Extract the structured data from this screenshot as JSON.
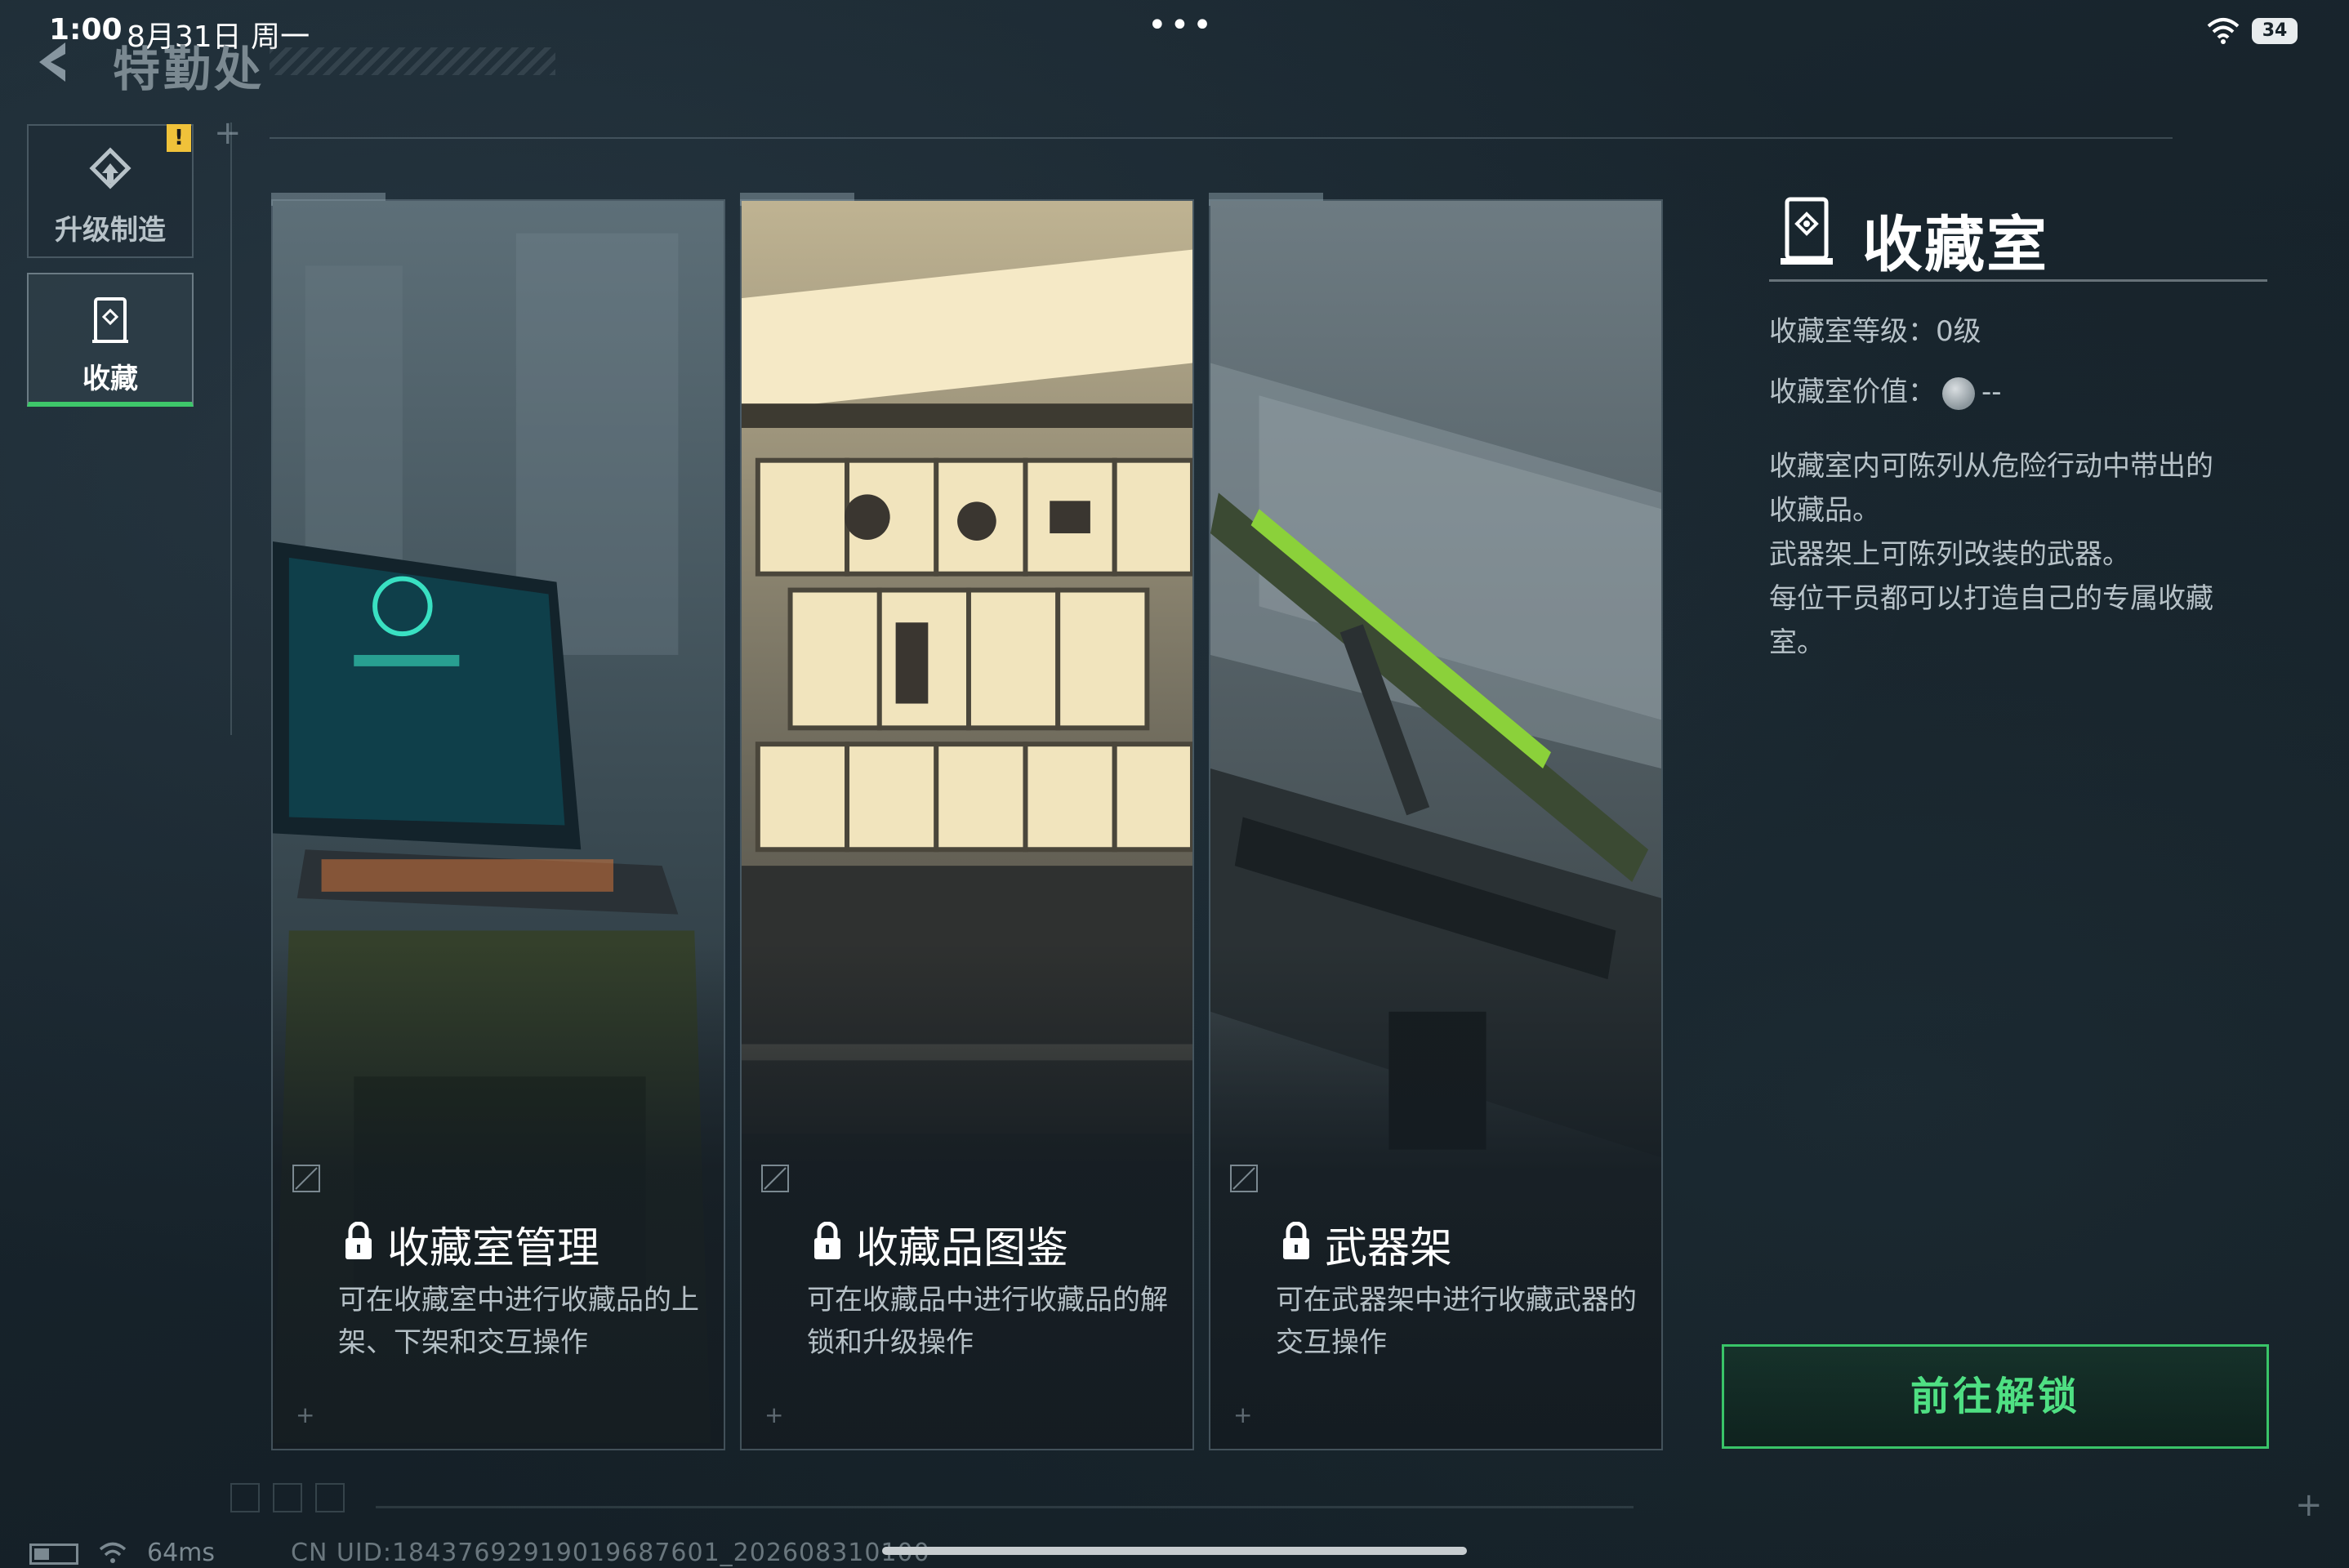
{
  "status_bar": {
    "time": "1:00",
    "date": "8月31日 周一",
    "more_dots": "•••",
    "battery": "34"
  },
  "header": {
    "title": "特勤处"
  },
  "sidebar": {
    "items": [
      {
        "label": "升级制造",
        "icon": "upgrade-craft-icon",
        "active": false,
        "alert": "!"
      },
      {
        "label": "收藏",
        "icon": "collection-room-icon",
        "active": true
      }
    ]
  },
  "cards": [
    {
      "title": "收藏室管理",
      "desc": "可在收藏室中进行收藏品的上架、下架和交互操作",
      "locked": true
    },
    {
      "title": "收藏品图鉴",
      "desc": "可在收藏品中进行收藏品的解锁和升级操作",
      "locked": true
    },
    {
      "title": "武器架",
      "desc": "可在武器架中进行收藏武器的交互操作",
      "locked": true
    }
  ],
  "panel": {
    "title": "收藏室",
    "level_label": "收藏室等级：",
    "level_value": "0级",
    "value_label": "收藏室价值：",
    "value_value": "--",
    "description": [
      "收藏室内可陈列从危险行动中带出的",
      "收藏品。",
      "武器架上可陈列改装的武器。",
      "每位干员都可以打造自己的专属收藏",
      "室。"
    ],
    "unlock_button": "前往解锁"
  },
  "footer": {
    "ping": "64ms",
    "uid": "CN UID:18437692919019687601_202608310100"
  },
  "colors": {
    "accent": "#3ec76a",
    "accent_text": "#4fe083",
    "alert": "#f0c23a",
    "background": "#17232b"
  }
}
